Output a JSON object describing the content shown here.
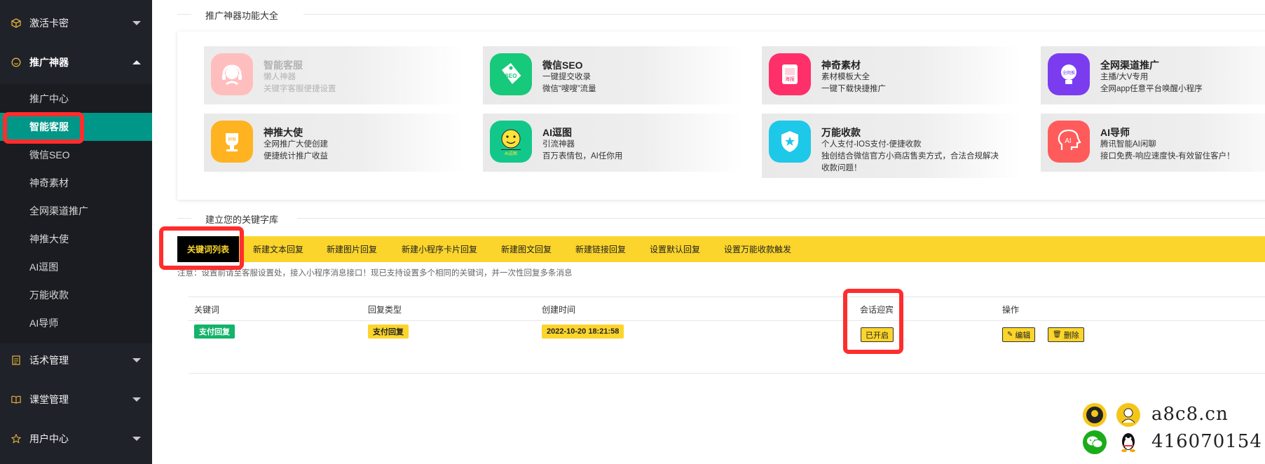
{
  "sidebar": {
    "top_items": [
      {
        "label": "激活卡密",
        "icon": "cube-icon"
      },
      {
        "label": "推广神器",
        "icon": "smile-icon"
      },
      {
        "label": "话术管理",
        "icon": "document-icon"
      },
      {
        "label": "课堂管理",
        "icon": "book-icon"
      },
      {
        "label": "用户中心",
        "icon": "star-icon"
      }
    ],
    "sub_items": [
      "推广中心",
      "智能客服",
      "微信SEO",
      "神奇素材",
      "全网渠道推广",
      "神推大使",
      "AI逗图",
      "万能收款",
      "AI导师"
    ],
    "active_sub": "智能客服"
  },
  "main": {
    "section1_title": "推广神器功能大全",
    "cards": [
      {
        "title": "智能客服",
        "lines": [
          "懒人神器",
          "关键字客服便捷设置"
        ],
        "color": "#ff8f8f",
        "icon_label": "",
        "dim": true
      },
      {
        "title": "微信SEO",
        "lines": [
          "一键提交收录",
          "微信“嗖嗖”流量"
        ],
        "color": "#17c97a",
        "icon_label": "SEO"
      },
      {
        "title": "神奇素材",
        "lines": [
          "素材模板大全",
          "一键下载快捷推广"
        ],
        "color": "#ff2f6a",
        "icon_label": "海报"
      },
      {
        "title": "全网渠道推广",
        "lines": [
          "主播/大V专用",
          "全网app任意平台唤醒小程序"
        ],
        "color": "#7b3cf0",
        "icon_label": "全网推"
      },
      {
        "title": "神推大使",
        "lines": [
          "全网推广大使创建",
          "便捷统计推广收益"
        ],
        "color": "#ffb320",
        "icon_label": "神推"
      },
      {
        "title": "AI逗图",
        "lines": [
          "引流神器",
          "百万表情包，AI任你用"
        ],
        "color": "#11c88a",
        "icon_label": "AI逗图"
      },
      {
        "title": "万能收款",
        "lines": [
          "个人支付-IOS支付-便捷收款",
          "独创结合微信官方小商店售卖方式，合法合规解决",
          "收款问题！"
        ],
        "color": "#1ec8e8",
        "icon_label": ""
      },
      {
        "title": "AI导师",
        "lines": [
          "腾讯智能AI闲聊",
          "接口免费-响应速度快-有效留住客户！"
        ],
        "color": "#ff5b5b",
        "icon_label": "AI"
      }
    ],
    "section2_title": "建立您的关键字库",
    "tabs": [
      "关键词列表",
      "新建文本回复",
      "新建图片回复",
      "新建小程序卡片回复",
      "新建图文回复",
      "新建链接回复",
      "设置默认回复",
      "设置万能收款触发"
    ],
    "note": "注意：设置前请至客服设置处，接入小程序消息接口！现已支持设置多个相同的关键词，并一次性回复多条消息",
    "table": {
      "headers": [
        "关键词",
        "回复类型",
        "创建时间",
        "会话迎宾",
        "操作"
      ],
      "rows": [
        {
          "keyword": "支付回复",
          "type": "支付回复",
          "created": "2022-10-20 18:21:58",
          "greeting": "已开启",
          "edit": "编辑",
          "delete": "删除"
        }
      ]
    }
  },
  "watermark": {
    "site": "a8c8.cn",
    "qq": "416070154"
  },
  "colors": {
    "sidebar_bg": "#20222a",
    "active_teal": "#009688",
    "accent_yellow": "#fbd52b",
    "keyword_green": "#13b36a",
    "highlight_red": "#ff2d2d"
  }
}
